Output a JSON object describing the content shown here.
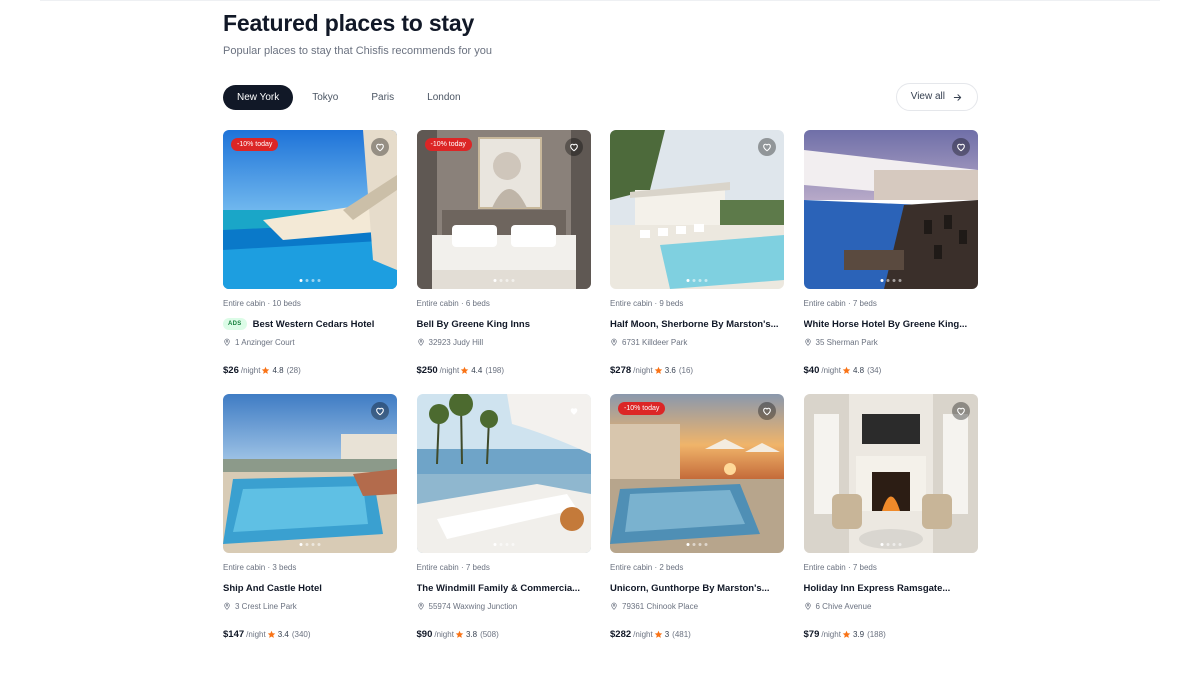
{
  "header": {
    "title": "Featured places to stay",
    "subtitle": "Popular places to stay that Chisfis recommends for you"
  },
  "tabs": [
    {
      "label": "New York",
      "active": true
    },
    {
      "label": "Tokyo",
      "active": false
    },
    {
      "label": "Paris",
      "active": false
    },
    {
      "label": "London",
      "active": false
    }
  ],
  "view_all_label": "View all",
  "colors": {
    "accent_dark": "#111827",
    "sale_badge": "#dc2626",
    "star": "#f97316",
    "ads_badge_bg": "#dcfce7"
  },
  "listings": [
    {
      "discount": "-10% today",
      "meta": "Entire cabin · 10 beds",
      "ads": "ADS",
      "name": "Best Western Cedars Hotel",
      "address": "1 Anzinger Court",
      "price": "$26",
      "per": "/night",
      "rating": "4.8",
      "reviews": "(28)",
      "favorited": false,
      "scene": "sea-pool"
    },
    {
      "discount": "-10% today",
      "meta": "Entire cabin · 6 beds",
      "ads": "",
      "name": "Bell By Greene King Inns",
      "address": "32923 Judy Hill",
      "price": "$250",
      "per": "/night",
      "rating": "4.4",
      "reviews": "(198)",
      "favorited": false,
      "scene": "bedroom"
    },
    {
      "discount": "",
      "meta": "Entire cabin · 9 beds",
      "ads": "",
      "name": "Half Moon, Sherborne By Marston's...",
      "address": "6731 Killdeer Park",
      "price": "$278",
      "per": "/night",
      "rating": "3.6",
      "reviews": "(16)",
      "favorited": false,
      "scene": "white-pool"
    },
    {
      "discount": "",
      "meta": "Entire cabin · 7 beds",
      "ads": "",
      "name": "White Horse Hotel By Greene King...",
      "address": "35 Sherman Park",
      "price": "$40",
      "per": "/night",
      "rating": "4.8",
      "reviews": "(34)",
      "favorited": false,
      "scene": "dusk-pool"
    },
    {
      "discount": "",
      "meta": "Entire cabin · 3 beds",
      "ads": "",
      "name": "Ship And Castle Hotel",
      "address": "3 Crest Line Park",
      "price": "$147",
      "per": "/night",
      "rating": "3.4",
      "reviews": "(340)",
      "favorited": false,
      "scene": "villa-pool"
    },
    {
      "discount": "",
      "meta": "Entire cabin · 7 beds",
      "ads": "",
      "name": "The Windmill Family & Commercia...",
      "address": "55974 Waxwing Junction",
      "price": "$90",
      "per": "/night",
      "rating": "3.8",
      "reviews": "(508)",
      "favorited": true,
      "scene": "loungers"
    },
    {
      "discount": "-10% today",
      "meta": "Entire cabin · 2 beds",
      "ads": "",
      "name": "Unicorn, Gunthorpe By Marston's...",
      "address": "79361 Chinook Place",
      "price": "$282",
      "per": "/night",
      "rating": "3",
      "reviews": "(481)",
      "favorited": false,
      "scene": "sunset-pool"
    },
    {
      "discount": "",
      "meta": "Entire cabin · 7 beds",
      "ads": "",
      "name": "Holiday Inn Express Ramsgate...",
      "address": "6 Chive Avenue",
      "price": "$79",
      "per": "/night",
      "rating": "3.9",
      "reviews": "(188)",
      "favorited": false,
      "scene": "fireplace"
    }
  ]
}
